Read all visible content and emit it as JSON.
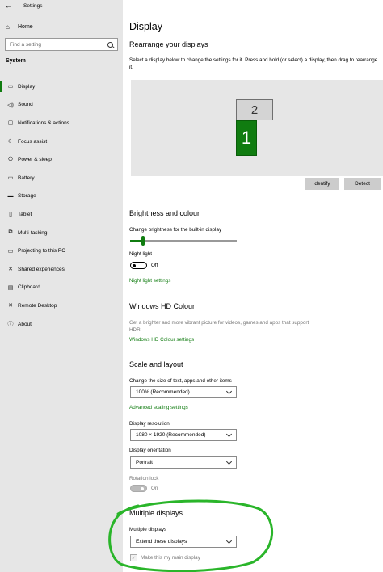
{
  "window": {
    "title": "Settings"
  },
  "sidebar": {
    "home_label": "Home",
    "search_placeholder": "Find a setting",
    "section_label": "System",
    "items": [
      {
        "label": "Display",
        "icon": "monitor-icon"
      },
      {
        "label": "Sound",
        "icon": "speaker-icon"
      },
      {
        "label": "Notifications & actions",
        "icon": "notification-icon"
      },
      {
        "label": "Focus assist",
        "icon": "moon-icon"
      },
      {
        "label": "Power & sleep",
        "icon": "power-icon"
      },
      {
        "label": "Battery",
        "icon": "battery-icon"
      },
      {
        "label": "Storage",
        "icon": "storage-icon"
      },
      {
        "label": "Tablet",
        "icon": "tablet-icon"
      },
      {
        "label": "Multi-tasking",
        "icon": "multitasking-icon"
      },
      {
        "label": "Projecting to this PC",
        "icon": "projector-icon"
      },
      {
        "label": "Shared experiences",
        "icon": "shared-icon"
      },
      {
        "label": "Clipboard",
        "icon": "clipboard-icon"
      },
      {
        "label": "Remote Desktop",
        "icon": "remote-icon"
      },
      {
        "label": "About",
        "icon": "info-icon"
      }
    ]
  },
  "main": {
    "title": "Display",
    "rearrange": {
      "heading": "Rearrange your displays",
      "description": "Select a display below to change the settings for it. Press and hold (or select) a display, then drag to rearrange it.",
      "monitor_primary": "1",
      "monitor_secondary": "2",
      "identify_label": "Identify",
      "detect_label": "Detect"
    },
    "brightness": {
      "heading": "Brightness and colour",
      "slider_label": "Change brightness for the built-in display",
      "brightness_percent": 12,
      "night_light_label": "Night light",
      "night_light_state": "Off",
      "night_light_link": "Night light settings"
    },
    "hd_colour": {
      "heading": "Windows HD Colour",
      "description": "Get a brighter and more vibrant picture for videos, games and apps that support HDR.",
      "link": "Windows HD Colour settings"
    },
    "scale": {
      "heading": "Scale and layout",
      "size_label": "Change the size of text, apps and other items",
      "size_value": "100% (Recommended)",
      "advanced_link": "Advanced scaling settings",
      "resolution_label": "Display resolution",
      "resolution_value": "1080 × 1920 (Recommended)",
      "orientation_label": "Display orientation",
      "orientation_value": "Portrait",
      "rotation_lock_label": "Rotation lock",
      "rotation_lock_state": "On"
    },
    "multiple": {
      "heading": "Multiple displays",
      "label": "Multiple displays",
      "value": "Extend these displays",
      "main_display_label": "Make this my main display"
    }
  },
  "colors": {
    "accent": "#107c10",
    "sidebar_bg": "#e6e6e6",
    "highlight_ring": "#2ab52a"
  }
}
